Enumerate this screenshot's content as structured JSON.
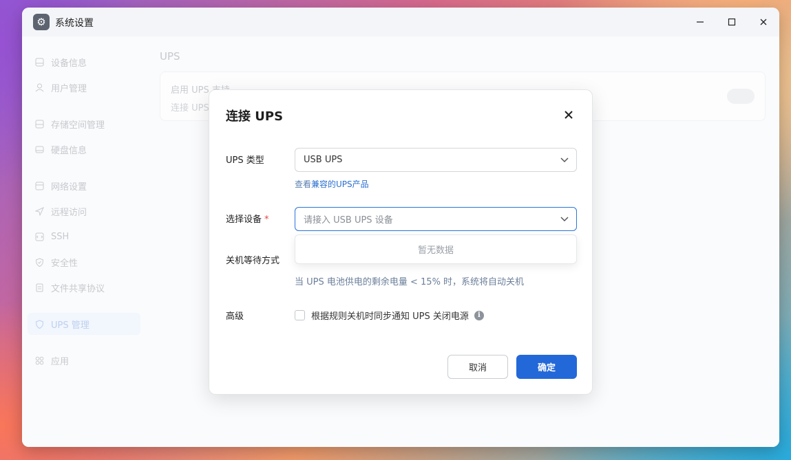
{
  "window": {
    "title": "系统设置",
    "icon": "gear-icon",
    "controls": [
      "minimize-icon",
      "maximize-icon",
      "close-icon"
    ]
  },
  "sidebar": {
    "items": [
      {
        "label": "设备信息",
        "icon": "device-icon"
      },
      {
        "label": "用户管理",
        "icon": "user-icon"
      },
      {
        "label": "存储空间管理",
        "icon": "storage-icon"
      },
      {
        "label": "硬盘信息",
        "icon": "disk-icon"
      },
      {
        "label": "网络设置",
        "icon": "network-icon"
      },
      {
        "label": "远程访问",
        "icon": "send-icon"
      },
      {
        "label": "SSH",
        "icon": "code-icon"
      },
      {
        "label": "安全性",
        "icon": "shield-check-icon"
      },
      {
        "label": "文件共享协议",
        "icon": "file-icon"
      },
      {
        "label": "UPS 管理",
        "icon": "shield-icon",
        "active": true
      },
      {
        "label": "应用",
        "icon": "apps-icon"
      }
    ]
  },
  "main": {
    "title": "UPS",
    "card": {
      "title": "启用 UPS 支持",
      "subtitle": "连接 UPS"
    }
  },
  "dialog": {
    "title": "连接 UPS",
    "ups_type": {
      "label": "UPS 类型",
      "value": "USB UPS",
      "link_prefix": "查看",
      "link_text": "兼容的UPS产品"
    },
    "device": {
      "label": "选择设备",
      "required_mark": "*",
      "placeholder": "请接入 USB UPS 设备",
      "dropdown_empty": "暂无数据"
    },
    "shutdown": {
      "label": "关机等待方式",
      "hint": "当 UPS 电池供电的剩余电量 < 15% 时，系统将自动关机"
    },
    "advanced": {
      "label": "高级",
      "checkbox_label": "根据规则关机时同步通知 UPS 关闭电源",
      "checked": false
    },
    "buttons": {
      "cancel": "取消",
      "ok": "确定"
    }
  },
  "colors": {
    "accent": "#2368d8",
    "required": "#e54545"
  }
}
